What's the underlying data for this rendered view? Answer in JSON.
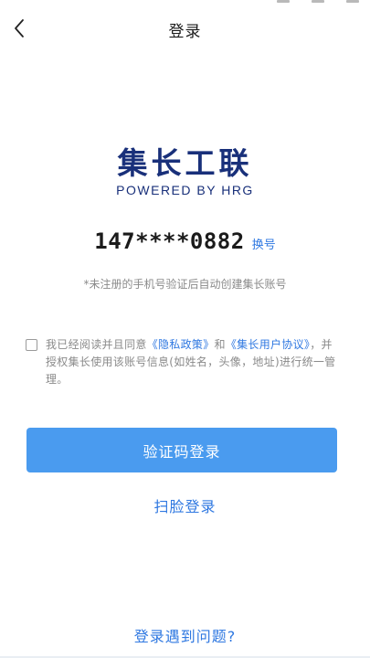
{
  "header": {
    "title": "登录"
  },
  "logo": {
    "name_cn": "集长工联",
    "tagline": "POWERED BY HRG"
  },
  "account": {
    "phone_masked": "147****0882",
    "switch_label": "换号",
    "hint": "*未注册的手机号验证后自动创建集长账号"
  },
  "agreement": {
    "checked": false,
    "prefix": "我已经阅读并且同意",
    "privacy_link": "《隐私政策》",
    "joiner": "和",
    "user_link": "《集长用户协议》",
    "suffix": "，并授权集长使用该账号信息(如姓名，头像，地址)进行统一管理。"
  },
  "actions": {
    "sms_login": "验证码登录",
    "face_login": "扫脸登录",
    "help": "登录遇到问题?"
  },
  "colors": {
    "primary": "#4a9bef",
    "link": "#2f78e1",
    "brand": "#19307a"
  }
}
